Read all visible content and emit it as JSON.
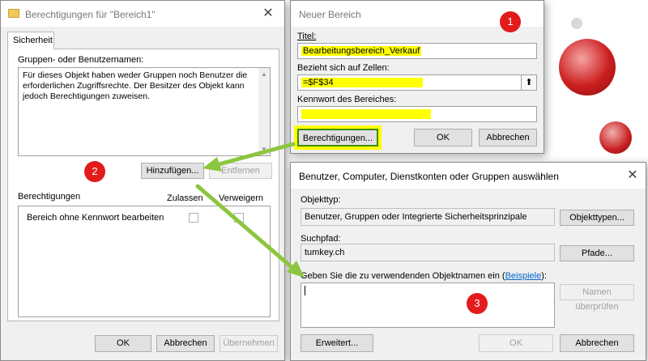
{
  "dialog1": {
    "title": "Berechtigungen für \"Bereich1\"",
    "tab": "Sicherheit",
    "groups_label": "Gruppen- oder Benutzernamen:",
    "info_text": "Für dieses Objekt haben weder Gruppen noch Benutzer die erforderlichen Zugriffsrechte. Der Besitzer des Objekt kann jedoch Berechtigungen zuweisen.",
    "add_button": "Hinzufügen...",
    "remove_button": "Entfernen",
    "perm_label": "Berechtigungen",
    "allow_col": "Zulassen",
    "deny_col": "Verweigern",
    "perm_row": "Bereich ohne Kennwort bearbeiten",
    "ok": "OK",
    "cancel": "Abbrechen",
    "apply": "Übernehmen"
  },
  "dialog2": {
    "title": "Neuer Bereich",
    "title_label": "Titel:",
    "title_value": "Bearbeitungsbereich_Verkauf",
    "cells_label": "Bezieht sich auf Zellen:",
    "cells_value": "=$F$34",
    "password_label": "Kennwort des Bereiches:",
    "perm_button": "Berechtigungen...",
    "ok": "OK",
    "cancel": "Abbrechen"
  },
  "dialog3": {
    "title": "Benutzer, Computer, Dienstkonten oder Gruppen auswählen",
    "objtype_label": "Objekttyp:",
    "objtype_value": "Benutzer, Gruppen oder Integrierte Sicherheitsprinzipale",
    "objtype_button": "Objekttypen...",
    "path_label": "Suchpfad:",
    "path_value": "tumkey.ch",
    "path_button": "Pfade...",
    "names_label": "Geben Sie die zu verwendenden Objektnamen ein (",
    "names_link": "Beispiele",
    "names_label_end": "):",
    "check_button": "Namen überprüfen",
    "advanced_button": "Erweitert...",
    "ok": "OK",
    "cancel": "Abbrechen"
  },
  "badges": [
    "1",
    "2",
    "3"
  ],
  "colors": {
    "highlight": "#ffff00",
    "badge": "#e31b1b",
    "arrow": "#8cc63f",
    "focus": "#3c8c00"
  },
  "icons": {
    "close": "close-icon",
    "folder": "folder-icon",
    "collapse": "collapse-range-icon"
  }
}
